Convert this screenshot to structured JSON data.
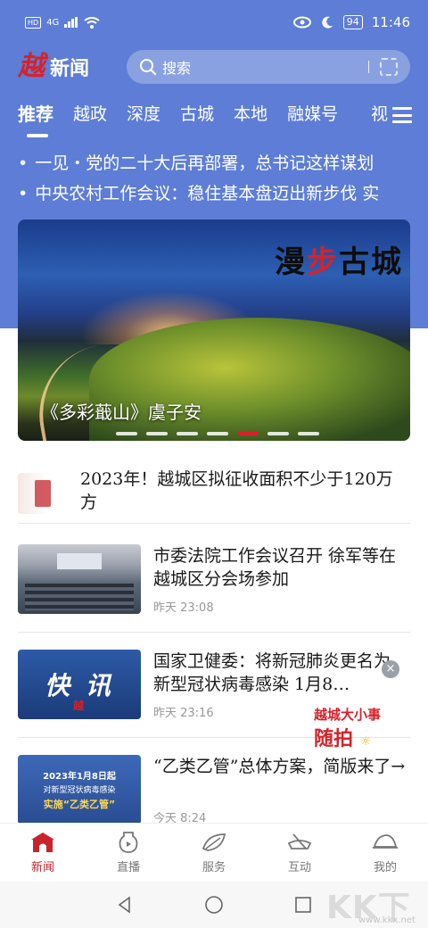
{
  "status_bar": {
    "hd": "HD",
    "signal": "4G",
    "battery": "94",
    "time": "11:46"
  },
  "header": {
    "logo_mark": "越",
    "logo_text": "新闻",
    "search_placeholder": "搜索"
  },
  "tabs": [
    "推荐",
    "越政",
    "深度",
    "古城",
    "本地",
    "融媒号",
    "视"
  ],
  "active_tab": "推荐",
  "ticker": [
    "一见・党的二十大后再部署，总书记这样谋划",
    "中央农村工作会议：稳住基本盘迈出新步伐 实"
  ],
  "carousel": {
    "brand_a": "漫",
    "brand_b": "步",
    "brand_c": "古城",
    "caption": "《多彩蕺山》虞子安",
    "slide_count": 7,
    "active_index": 4
  },
  "news": [
    {
      "title": "2023年！越城区拟征收面积不少于120万方",
      "time": ""
    },
    {
      "title": "市委法院工作会议召开 徐军等在越城区分会场参加",
      "time": "昨天  23:08"
    },
    {
      "title": "国家卫健委：将新冠肺炎更名为新型冠状病毒感染 1月8…",
      "time": "昨天  23:16",
      "thumb_text": "快 讯",
      "thumb_mark": "越"
    },
    {
      "title": "“乙类乙管”总体方案，简版来了→",
      "time": "今天  8:24",
      "thumb_l1": "2023年1月8日起",
      "thumb_l2": "对新型冠状病毒感染",
      "thumb_l3": "实施“乙类乙管”"
    }
  ],
  "float_promo": {
    "close": "×",
    "line1": "越城大小事",
    "line2": "随拍",
    "sun": "☼"
  },
  "bottom_nav": [
    {
      "label": "新闻",
      "icon": "city-gate-icon",
      "active": true
    },
    {
      "label": "直播",
      "icon": "vase-icon",
      "active": false
    },
    {
      "label": "服务",
      "icon": "leaf-icon",
      "active": false
    },
    {
      "label": "互动",
      "icon": "boat-icon",
      "active": false
    },
    {
      "label": "我的",
      "icon": "hat-icon",
      "active": false
    }
  ],
  "watermark": {
    "text": "KK下载",
    "url": "www.kkx.net"
  },
  "colors": {
    "header_blue": "#5d7dd6",
    "brand_red": "#d6222a",
    "nav_active": "#c8232c"
  }
}
